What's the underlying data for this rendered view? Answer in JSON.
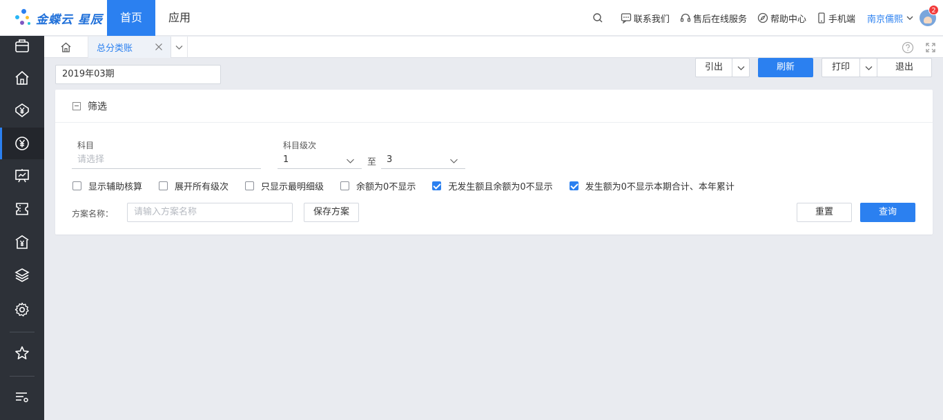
{
  "app": {
    "logo_text": "金蝶云 星辰",
    "nav_tabs": [
      {
        "label": "首页",
        "active": true
      },
      {
        "label": "应用",
        "active": false
      }
    ],
    "top_links": [
      {
        "icon": "search-icon",
        "label": ""
      },
      {
        "icon": "chat-icon",
        "label": "联系我们"
      },
      {
        "icon": "headset-icon",
        "label": "售后在线服务"
      },
      {
        "icon": "compass-icon",
        "label": "帮助中心"
      },
      {
        "icon": "mobile-icon",
        "label": "手机端"
      }
    ],
    "user_name": "南京儒熙",
    "notification_count": "2",
    "accent_color": "#2b80f0"
  },
  "sidebar": {
    "items": [
      {
        "icon": "briefcase-icon",
        "active": false
      },
      {
        "icon": "home-icon",
        "active": false
      },
      {
        "icon": "finance-shield-icon",
        "active": false
      },
      {
        "icon": "yen-circle-icon",
        "active": true
      },
      {
        "icon": "report-chart-icon",
        "active": false
      },
      {
        "icon": "ticket-icon",
        "active": false
      },
      {
        "icon": "bank-icon",
        "active": false
      },
      {
        "icon": "layers-icon",
        "active": false
      },
      {
        "icon": "gear-icon",
        "active": false
      },
      {
        "icon": "star-icon",
        "active": false
      },
      {
        "icon": "menu-settings-icon",
        "active": false
      }
    ]
  },
  "tabs": {
    "home_icon": "home-icon",
    "open_tab_label": "总分类账",
    "tools": [
      "help-icon",
      "fullscreen-icon"
    ]
  },
  "toolbar": {
    "period_value": "2019年03期",
    "export_label": "引出",
    "refresh_label": "刷新",
    "print_label": "打印",
    "exit_label": "退出"
  },
  "filter": {
    "title": "筛选",
    "account_label": "科目",
    "account_placeholder": "请选择",
    "level_label": "科目级次",
    "level_from": "1",
    "to_label": "至",
    "level_to": "3",
    "checkboxes": [
      {
        "label": "显示辅助核算",
        "checked": false
      },
      {
        "label": "展开所有级次",
        "checked": false
      },
      {
        "label": "只显示最明细级",
        "checked": false
      },
      {
        "label": "余额为0不显示",
        "checked": false
      },
      {
        "label": "无发生额且余额为0不显示",
        "checked": true
      },
      {
        "label": "发生额为0不显示本期合计、本年累计",
        "checked": true
      }
    ],
    "scheme_label": "方案名称：",
    "scheme_placeholder": "请输入方案名称",
    "save_scheme_label": "保存方案",
    "reset_label": "重置",
    "query_label": "查询"
  }
}
